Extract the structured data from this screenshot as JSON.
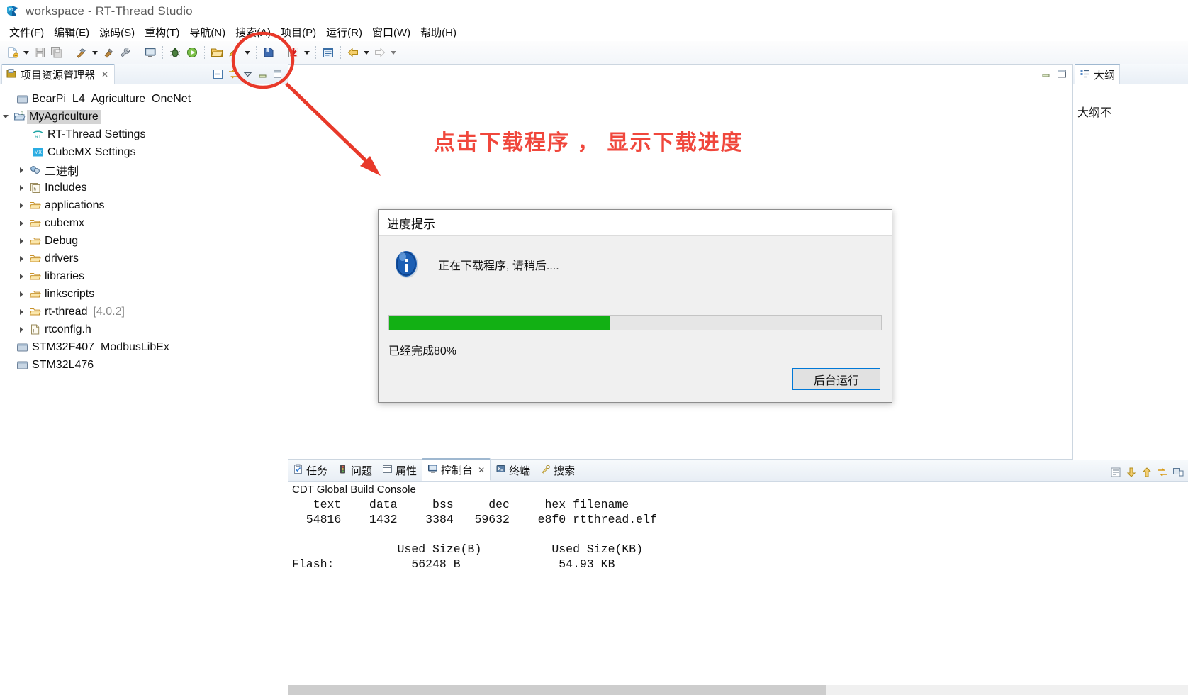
{
  "window": {
    "title": "workspace - RT-Thread Studio",
    "logo_icon": "rt-thread-logo-icon"
  },
  "menubar": {
    "items": [
      {
        "label": "文件(F)",
        "name": "menu-file"
      },
      {
        "label": "编辑(E)",
        "name": "menu-edit"
      },
      {
        "label": "源码(S)",
        "name": "menu-source"
      },
      {
        "label": "重构(T)",
        "name": "menu-refactor"
      },
      {
        "label": "导航(N)",
        "name": "menu-navigate"
      },
      {
        "label": "搜索(A)",
        "name": "menu-search"
      },
      {
        "label": "项目(P)",
        "name": "menu-project"
      },
      {
        "label": "运行(R)",
        "name": "menu-run"
      },
      {
        "label": "窗口(W)",
        "name": "menu-window"
      },
      {
        "label": "帮助(H)",
        "name": "menu-help"
      }
    ]
  },
  "toolbar": {
    "icons": [
      "new-file-icon",
      "dropdown-caret-icon",
      "save-icon",
      "save-all-icon",
      "build-hammer-icon",
      "dropdown-caret-icon",
      "clean-icon",
      "wrench-icon",
      "terminal-icon",
      "debug-bug-icon",
      "run-icon",
      "open-folder-icon",
      "pencil-icon",
      "dropdown-caret-icon",
      "bookmark-icon",
      "download-flash-icon",
      "dropdown-caret-icon",
      "register-icon",
      "back-arrow-icon",
      "dropdown-caret-icon",
      "forward-arrow-icon",
      "dropdown-caret-icon"
    ],
    "highlighted_icon": "download-flash-icon"
  },
  "project_explorer": {
    "tab_label": "项目资源管理器",
    "tab_close": "✕",
    "tools": [
      "collapse-all-icon",
      "link-with-editor-icon",
      "view-menu-icon",
      "minimize-icon",
      "maximize-icon"
    ],
    "tree": [
      {
        "label": "BearPi_L4_Agriculture_OneNet",
        "icon": "closed-project-icon",
        "indent": 1,
        "arrow": "none",
        "selected": false
      },
      {
        "label": "MyAgriculture",
        "icon": "open-project-icon",
        "indent": 0,
        "arrow": "open",
        "selected": true
      },
      {
        "label": "RT-Thread Settings",
        "icon": "rt-settings-icon",
        "indent": 2,
        "arrow": "none",
        "selected": false
      },
      {
        "label": "CubeMX Settings",
        "icon": "cubemx-icon",
        "indent": 2,
        "arrow": "none",
        "selected": false
      },
      {
        "label": "二进制",
        "icon": "binaries-icon",
        "indent": 1,
        "arrow": "closed",
        "selected": false
      },
      {
        "label": "Includes",
        "icon": "includes-icon",
        "indent": 1,
        "arrow": "closed",
        "selected": false
      },
      {
        "label": "applications",
        "icon": "source-folder-icon",
        "indent": 1,
        "arrow": "closed",
        "selected": false
      },
      {
        "label": "cubemx",
        "icon": "source-folder-icon",
        "indent": 1,
        "arrow": "closed",
        "selected": false
      },
      {
        "label": "Debug",
        "icon": "source-folder-icon",
        "indent": 1,
        "arrow": "closed",
        "selected": false
      },
      {
        "label": "drivers",
        "icon": "source-folder-icon",
        "indent": 1,
        "arrow": "closed",
        "selected": false
      },
      {
        "label": "libraries",
        "icon": "source-folder-icon",
        "indent": 1,
        "arrow": "closed",
        "selected": false
      },
      {
        "label": "linkscripts",
        "icon": "source-folder-icon",
        "indent": 1,
        "arrow": "closed",
        "selected": false
      },
      {
        "label": "rt-thread",
        "version": "[4.0.2]",
        "icon": "source-folder-icon",
        "indent": 1,
        "arrow": "closed",
        "selected": false
      },
      {
        "label": "rtconfig.h",
        "icon": "header-file-icon",
        "indent": 1,
        "arrow": "closed",
        "selected": false
      },
      {
        "label": "STM32F407_ModbusLibEx",
        "icon": "closed-project-icon",
        "indent": 1,
        "arrow": "none",
        "selected": false
      },
      {
        "label": "STM32L476",
        "icon": "closed-project-icon",
        "indent": 1,
        "arrow": "none",
        "selected": false
      }
    ]
  },
  "annotation": {
    "text": "点击下载程序 ， 显示下载进度",
    "color": "#f0473c"
  },
  "outline": {
    "tab_label": "大纲",
    "tab_icon": "outline-icon",
    "body_text": "大纲不"
  },
  "dialog": {
    "title": "进度提示",
    "icon": "info-icon",
    "message": "正在下载程序, 请稍后....",
    "progress_percent": 45,
    "progress_label": "已经完成80%",
    "progress_color": "#12b014",
    "button_label": "后台运行",
    "button_focus_color": "#0078d7"
  },
  "console": {
    "tabs": [
      {
        "label": "任务",
        "icon": "tasks-icon",
        "active": false
      },
      {
        "label": "问题",
        "icon": "problems-icon",
        "active": false
      },
      {
        "label": "属性",
        "icon": "properties-icon",
        "active": false
      },
      {
        "label": "控制台",
        "icon": "console-icon",
        "active": true,
        "close": "✕"
      },
      {
        "label": "终端",
        "icon": "terminal-icon",
        "active": false
      },
      {
        "label": "搜索",
        "icon": "search-icon",
        "active": false
      }
    ],
    "tools": [
      "word-wrap-icon",
      "scroll-down-icon",
      "scroll-up-icon",
      "pin-console-icon",
      "display-console-icon"
    ],
    "title": "CDT Global Build Console",
    "output": "   text\t   data\t    bss\t    dec\t    hex filename\n  54816\t   1432\t   3384\t  59632\t   e8f0 rtthread.elf\n\n               Used Size(B)          Used Size(KB)\nFlash:           56248 B              54.93 KB"
  }
}
